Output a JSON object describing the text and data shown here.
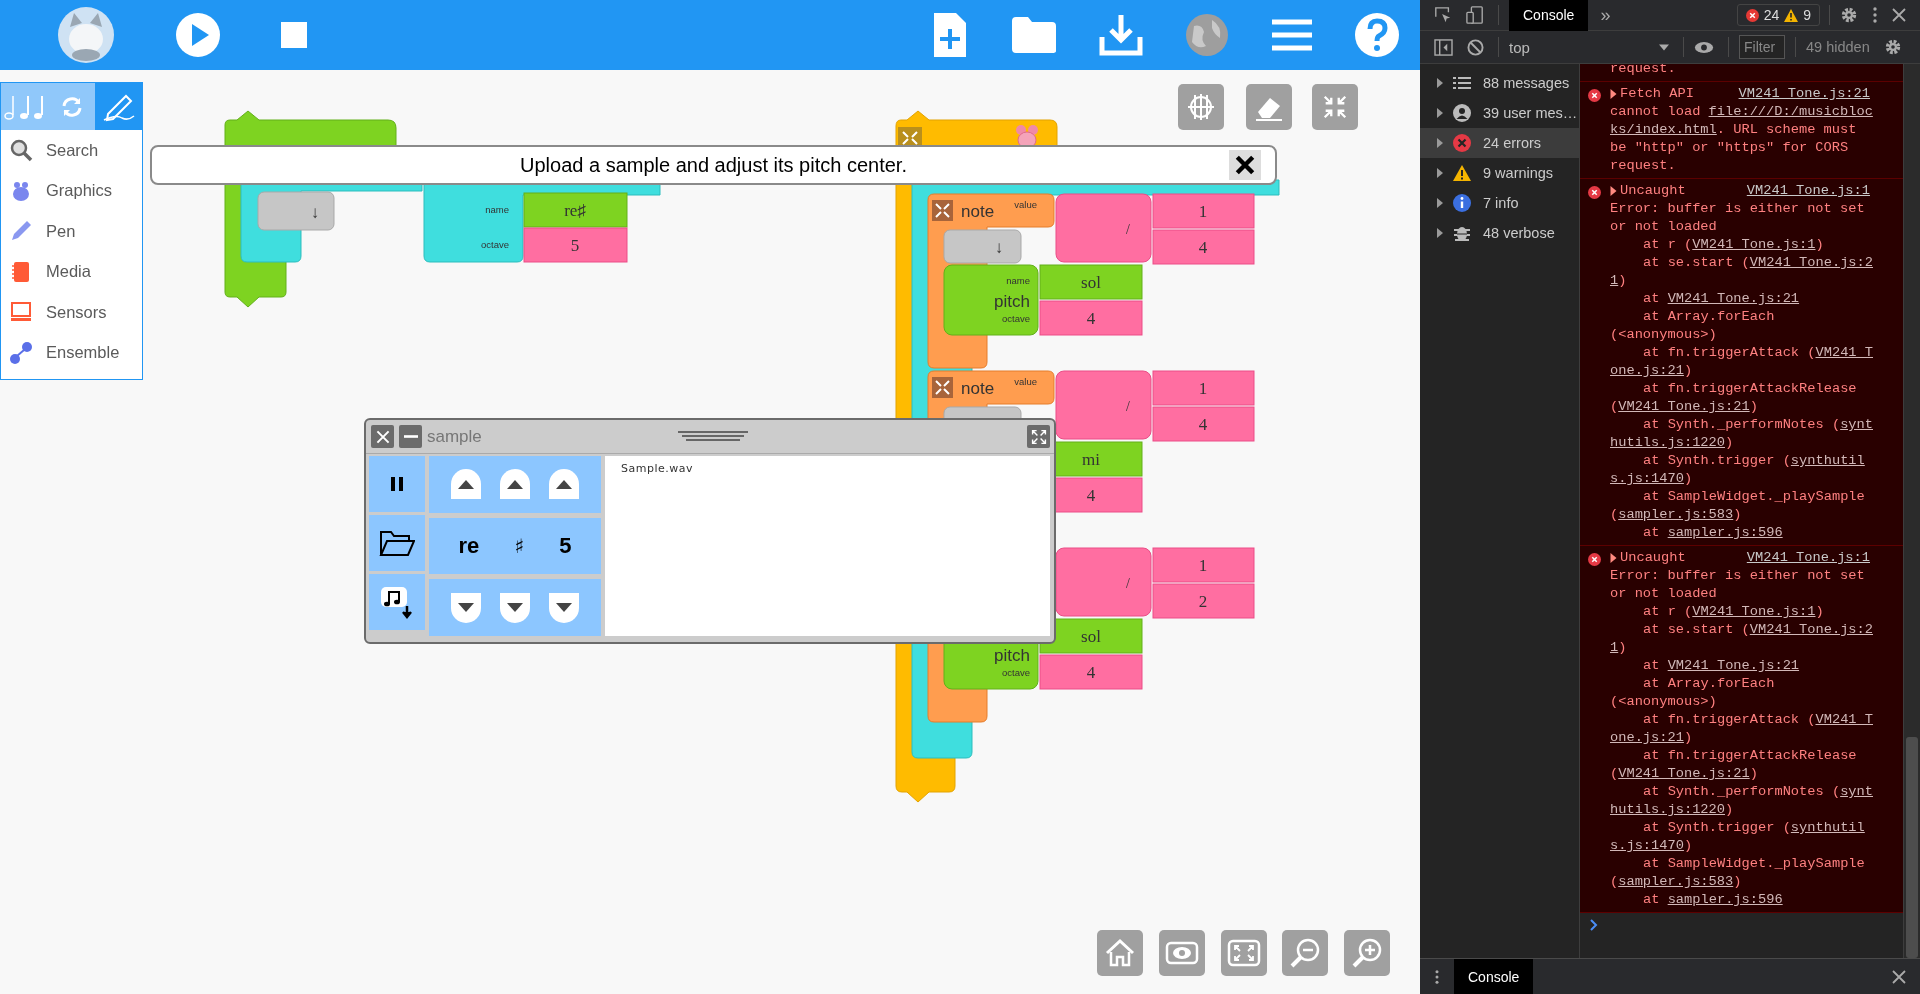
{
  "palette": {
    "tabs": [
      {
        "kind": "notes",
        "selected": false
      },
      {
        "kind": "refresh",
        "selected": false
      },
      {
        "kind": "pen",
        "selected": true
      }
    ],
    "items": [
      {
        "kind": "search",
        "label": "Search"
      },
      {
        "kind": "graphics",
        "label": "Graphics"
      },
      {
        "kind": "pen",
        "label": "Pen"
      },
      {
        "kind": "media",
        "label": "Media"
      },
      {
        "kind": "sensors",
        "label": "Sensors"
      },
      {
        "kind": "ensemble",
        "label": "Ensemble"
      }
    ]
  },
  "message": {
    "text": "Upload a sample and adjust its pitch center."
  },
  "sampler_stack": {
    "arrow": "↓",
    "sample": {
      "name_label": "name",
      "name": "re♯",
      "octave_label": "octave",
      "octave": "5"
    }
  },
  "start_stack": {
    "notes": [
      {
        "label": "note",
        "value_label": "value",
        "operator": "/",
        "numerator": "1",
        "denominator": "4",
        "arrow": "↓",
        "pitch": {
          "name_label": "name",
          "label": "pitch",
          "octave_label": "octave",
          "name": "sol",
          "octave": "4"
        }
      },
      {
        "label": "note",
        "value_label": "value",
        "operator": "/",
        "numerator": "1",
        "denominator": "4",
        "pitch": {
          "name": "mi",
          "octave": "4"
        }
      },
      {
        "operator": "/",
        "numerator": "1",
        "denominator": "2",
        "pitch": {
          "label": "pitch",
          "octave_label": "octave",
          "name": "sol",
          "octave": "4"
        }
      }
    ]
  },
  "widget": {
    "title": "sample",
    "note": "re",
    "accidental": "♯",
    "octave": "5",
    "file": "Sample.wav"
  },
  "devtools": {
    "tabs": [
      {
        "label": "Console",
        "selected": true
      }
    ],
    "more": "»",
    "errors": "24",
    "warnings": "9",
    "context": "top",
    "filter_placeholder": "Filter",
    "hidden": "49 hidden",
    "sidebar": [
      {
        "kind": "messages",
        "label": "88 messages",
        "selected": false
      },
      {
        "kind": "user",
        "label": "39 user mes…",
        "selected": false
      },
      {
        "kind": "errors",
        "label": "24 errors",
        "selected": true
      },
      {
        "kind": "warnings",
        "label": "9 warnings",
        "selected": false
      },
      {
        "kind": "info",
        "label": "7 info",
        "selected": false
      },
      {
        "kind": "verbose",
        "label": "48 verbose",
        "selected": false
      }
    ],
    "messages": [
      {
        "kind": "error",
        "lines": [
          {
            "indent": false,
            "parts": [
              {
                "text": "request."
              }
            ]
          }
        ]
      },
      {
        "kind": "error",
        "head": "Fetch API",
        "source": "VM241 Tone.js:21",
        "lines": [
          {
            "indent": false,
            "parts": [
              {
                "text": "cannot load "
              },
              {
                "text": "file:///D:/musicbloc",
                "link": true
              }
            ]
          },
          {
            "indent": false,
            "parts": [
              {
                "text": "ks/index.html",
                "link": true
              },
              {
                "text": ". URL scheme must"
              }
            ]
          },
          {
            "indent": false,
            "parts": [
              {
                "text": "be \"http\" or \"https\" for CORS"
              }
            ]
          },
          {
            "indent": false,
            "parts": [
              {
                "text": "request."
              }
            ]
          }
        ]
      },
      {
        "kind": "error",
        "head": "Uncaught",
        "source": "VM241 Tone.js:1",
        "lines": [
          {
            "indent": false,
            "parts": [
              {
                "text": "Error: buffer is either not set"
              }
            ]
          },
          {
            "indent": false,
            "parts": [
              {
                "text": "or not loaded"
              }
            ]
          },
          {
            "indent": true,
            "parts": [
              {
                "text": "at r ("
              },
              {
                "text": "VM241 Tone.js:1",
                "link": true
              },
              {
                "text": ")"
              }
            ]
          },
          {
            "indent": true,
            "parts": [
              {
                "text": "at se.start ("
              },
              {
                "text": "VM241 Tone.js:2",
                "link": true
              }
            ]
          },
          {
            "indent": false,
            "parts": [
              {
                "text": "1",
                "link": true
              },
              {
                "text": ")"
              }
            ]
          },
          {
            "indent": true,
            "parts": [
              {
                "text": "at "
              },
              {
                "text": "VM241 Tone.js:21",
                "link": true
              }
            ]
          },
          {
            "indent": true,
            "parts": [
              {
                "text": "at Array.forEach"
              }
            ]
          },
          {
            "indent": false,
            "parts": [
              {
                "text": "(<anonymous>)"
              }
            ]
          },
          {
            "indent": true,
            "parts": [
              {
                "text": "at fn.triggerAttack ("
              },
              {
                "text": "VM241 T",
                "link": true
              }
            ]
          },
          {
            "indent": false,
            "parts": [
              {
                "text": "one.js:21",
                "link": true
              },
              {
                "text": ")"
              }
            ]
          },
          {
            "indent": true,
            "parts": [
              {
                "text": "at fn.triggerAttackRelease"
              }
            ]
          },
          {
            "indent": false,
            "parts": [
              {
                "text": "("
              },
              {
                "text": "VM241 Tone.js:21",
                "link": true
              },
              {
                "text": ")"
              }
            ]
          },
          {
            "indent": true,
            "parts": [
              {
                "text": "at Synth._performNotes ("
              },
              {
                "text": "synt",
                "link": true
              }
            ]
          },
          {
            "indent": false,
            "parts": [
              {
                "text": "hutils.js:1220",
                "link": true
              },
              {
                "text": ")"
              }
            ]
          },
          {
            "indent": true,
            "parts": [
              {
                "text": "at Synth.trigger ("
              },
              {
                "text": "synthutil",
                "link": true
              }
            ]
          },
          {
            "indent": false,
            "parts": [
              {
                "text": "s.js:1470",
                "link": true
              },
              {
                "text": ")"
              }
            ]
          },
          {
            "indent": true,
            "parts": [
              {
                "text": "at SampleWidget._playSample"
              }
            ]
          },
          {
            "indent": false,
            "parts": [
              {
                "text": "("
              },
              {
                "text": "sampler.js:583",
                "link": true
              },
              {
                "text": ")"
              }
            ]
          },
          {
            "indent": true,
            "parts": [
              {
                "text": "at "
              },
              {
                "text": "sampler.js:596",
                "link": true
              }
            ]
          }
        ]
      },
      {
        "kind": "error",
        "head": "Uncaught",
        "source": "VM241 Tone.js:1",
        "lines": [
          {
            "indent": false,
            "parts": [
              {
                "text": "Error: buffer is either not set"
              }
            ]
          },
          {
            "indent": false,
            "parts": [
              {
                "text": "or not loaded"
              }
            ]
          },
          {
            "indent": true,
            "parts": [
              {
                "text": "at r ("
              },
              {
                "text": "VM241 Tone.js:1",
                "link": true
              },
              {
                "text": ")"
              }
            ]
          },
          {
            "indent": true,
            "parts": [
              {
                "text": "at se.start ("
              },
              {
                "text": "VM241 Tone.js:2",
                "link": true
              }
            ]
          },
          {
            "indent": false,
            "parts": [
              {
                "text": "1",
                "link": true
              },
              {
                "text": ")"
              }
            ]
          },
          {
            "indent": true,
            "parts": [
              {
                "text": "at "
              },
              {
                "text": "VM241 Tone.js:21",
                "link": true
              }
            ]
          },
          {
            "indent": true,
            "parts": [
              {
                "text": "at Array.forEach"
              }
            ]
          },
          {
            "indent": false,
            "parts": [
              {
                "text": "(<anonymous>)"
              }
            ]
          },
          {
            "indent": true,
            "parts": [
              {
                "text": "at fn.triggerAttack ("
              },
              {
                "text": "VM241 T",
                "link": true
              }
            ]
          },
          {
            "indent": false,
            "parts": [
              {
                "text": "one.js:21",
                "link": true
              },
              {
                "text": ")"
              }
            ]
          },
          {
            "indent": true,
            "parts": [
              {
                "text": "at fn.triggerAttackRelease"
              }
            ]
          },
          {
            "indent": false,
            "parts": [
              {
                "text": "("
              },
              {
                "text": "VM241 Tone.js:21",
                "link": true
              },
              {
                "text": ")"
              }
            ]
          },
          {
            "indent": true,
            "parts": [
              {
                "text": "at Synth._performNotes ("
              },
              {
                "text": "synt",
                "link": true
              }
            ]
          },
          {
            "indent": false,
            "parts": [
              {
                "text": "hutils.js:1220",
                "link": true
              },
              {
                "text": ")"
              }
            ]
          },
          {
            "indent": true,
            "parts": [
              {
                "text": "at Synth.trigger ("
              },
              {
                "text": "synthutil",
                "link": true
              }
            ]
          },
          {
            "indent": false,
            "parts": [
              {
                "text": "s.js:1470",
                "link": true
              },
              {
                "text": ")"
              }
            ]
          },
          {
            "indent": true,
            "parts": [
              {
                "text": "at SampleWidget._playSample"
              }
            ]
          },
          {
            "indent": false,
            "parts": [
              {
                "text": "("
              },
              {
                "text": "sampler.js:583",
                "link": true
              },
              {
                "text": ")"
              }
            ]
          },
          {
            "indent": true,
            "parts": [
              {
                "text": "at "
              },
              {
                "text": "sampler.js:596",
                "link": true
              }
            ]
          }
        ]
      }
    ],
    "drawer_tabs": [
      {
        "label": "Console",
        "selected": true
      }
    ]
  }
}
